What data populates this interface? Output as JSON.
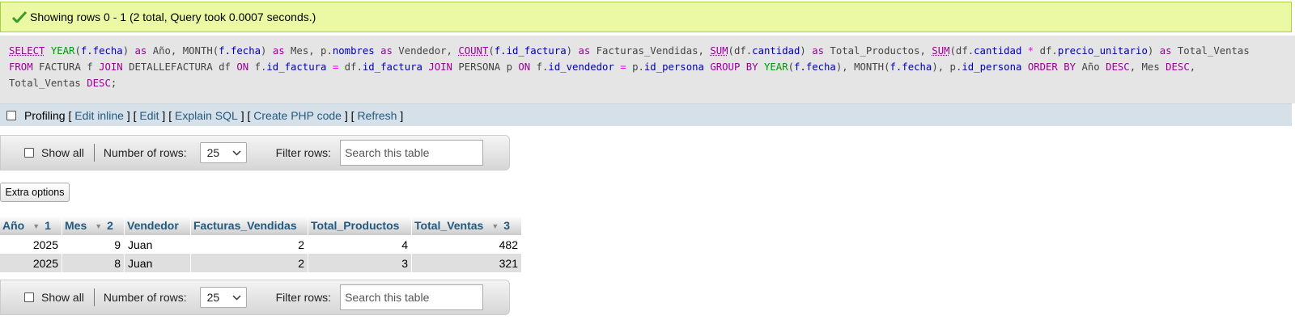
{
  "message": {
    "text": "Showing rows 0 - 1 (2 total, Query took 0.0007 seconds.)",
    "icon": "check-icon",
    "color": "#ebf8a4"
  },
  "sql": {
    "line1": [
      {
        "t": "SELECT",
        "c": "kwu"
      },
      {
        "t": " ",
        "c": "pl"
      },
      {
        "t": "YEAR",
        "c": "fn"
      },
      {
        "t": "(",
        "c": "pl"
      },
      {
        "t": "f.fecha",
        "c": "col"
      },
      {
        "t": ") ",
        "c": "pl"
      },
      {
        "t": "as",
        "c": "kw"
      },
      {
        "t": " Año, ",
        "c": "pl"
      },
      {
        "t": "MONTH",
        "c": "pl"
      },
      {
        "t": "(",
        "c": "pl"
      },
      {
        "t": "f.fecha",
        "c": "col"
      },
      {
        "t": ") ",
        "c": "pl"
      },
      {
        "t": "as",
        "c": "kw"
      },
      {
        "t": " Mes, p.",
        "c": "pl"
      },
      {
        "t": "nombres",
        "c": "col"
      },
      {
        "t": " ",
        "c": "pl"
      },
      {
        "t": "as",
        "c": "kw"
      },
      {
        "t": " Vendedor, ",
        "c": "pl"
      },
      {
        "t": "COUNT",
        "c": "fnu"
      },
      {
        "t": "(",
        "c": "pl"
      },
      {
        "t": "f.id_factura",
        "c": "col"
      },
      {
        "t": ") ",
        "c": "pl"
      },
      {
        "t": "as",
        "c": "kw"
      },
      {
        "t": " Facturas_Vendidas, ",
        "c": "pl"
      },
      {
        "t": "SUM",
        "c": "fnu"
      },
      {
        "t": "(df.",
        "c": "pl"
      },
      {
        "t": "cantidad",
        "c": "col"
      },
      {
        "t": ") ",
        "c": "pl"
      },
      {
        "t": "as",
        "c": "kw"
      },
      {
        "t": " Total_Productos, ",
        "c": "pl"
      },
      {
        "t": "SUM",
        "c": "fnu"
      },
      {
        "t": "(df.",
        "c": "pl"
      },
      {
        "t": "cantidad",
        "c": "col"
      },
      {
        "t": " ",
        "c": "pl"
      },
      {
        "t": "*",
        "c": "op"
      },
      {
        "t": " df.",
        "c": "pl"
      },
      {
        "t": "precio_unitario",
        "c": "col"
      },
      {
        "t": ") ",
        "c": "pl"
      },
      {
        "t": "as",
        "c": "kw"
      },
      {
        "t": " Total_Ventas",
        "c": "pl"
      }
    ],
    "line2": [
      {
        "t": "FROM",
        "c": "kw"
      },
      {
        "t": " FACTURA f ",
        "c": "pl"
      },
      {
        "t": "JOIN",
        "c": "kw"
      },
      {
        "t": " DETALLEFACTURA df ",
        "c": "pl"
      },
      {
        "t": "ON",
        "c": "kw"
      },
      {
        "t": " f.",
        "c": "pl"
      },
      {
        "t": "id_factura",
        "c": "col"
      },
      {
        "t": " ",
        "c": "pl"
      },
      {
        "t": "=",
        "c": "op"
      },
      {
        "t": " df.",
        "c": "pl"
      },
      {
        "t": "id_factura",
        "c": "col"
      },
      {
        "t": " ",
        "c": "pl"
      },
      {
        "t": "JOIN",
        "c": "kw"
      },
      {
        "t": " PERSONA p ",
        "c": "pl"
      },
      {
        "t": "ON",
        "c": "kw"
      },
      {
        "t": " f.",
        "c": "pl"
      },
      {
        "t": "id_vendedor",
        "c": "col"
      },
      {
        "t": " ",
        "c": "pl"
      },
      {
        "t": "=",
        "c": "op"
      },
      {
        "t": " p.",
        "c": "pl"
      },
      {
        "t": "id_persona",
        "c": "col"
      },
      {
        "t": " ",
        "c": "pl"
      },
      {
        "t": "GROUP BY",
        "c": "kw"
      },
      {
        "t": " ",
        "c": "pl"
      },
      {
        "t": "YEAR",
        "c": "fn"
      },
      {
        "t": "(",
        "c": "pl"
      },
      {
        "t": "f.fecha",
        "c": "col"
      },
      {
        "t": "), ",
        "c": "pl"
      },
      {
        "t": "MONTH",
        "c": "pl"
      },
      {
        "t": "(",
        "c": "pl"
      },
      {
        "t": "f.fecha",
        "c": "col"
      },
      {
        "t": "), p.",
        "c": "pl"
      },
      {
        "t": "id_persona",
        "c": "col"
      },
      {
        "t": " ",
        "c": "pl"
      },
      {
        "t": "ORDER BY",
        "c": "kw"
      },
      {
        "t": " Año ",
        "c": "pl"
      },
      {
        "t": "DESC",
        "c": "kw"
      },
      {
        "t": ", Mes ",
        "c": "pl"
      },
      {
        "t": "DESC",
        "c": "kw"
      },
      {
        "t": ",",
        "c": "pl"
      }
    ],
    "line3": [
      {
        "t": "Total_Ventas ",
        "c": "pl"
      },
      {
        "t": "DESC",
        "c": "kw"
      },
      {
        "t": ";",
        "c": "pl"
      }
    ]
  },
  "profiling": {
    "label": "Profiling",
    "open": " [ ",
    "sep": " ] [ ",
    "close": " ]",
    "links": [
      "Edit inline",
      "Edit",
      "Explain SQL",
      "Create PHP code",
      "Refresh"
    ]
  },
  "nav": {
    "show_all": "Show all",
    "rows_label": "Number of rows:",
    "rows_value": "25",
    "filter_label": "Filter rows:",
    "filter_placeholder": "Search this table"
  },
  "extra_options": "Extra options",
  "table": {
    "columns": [
      {
        "name": "Año",
        "sort": "1"
      },
      {
        "name": "Mes",
        "sort": "2"
      },
      {
        "name": "Vendedor"
      },
      {
        "name": "Facturas_Vendidas"
      },
      {
        "name": "Total_Productos"
      },
      {
        "name": "Total_Ventas",
        "sort": "3"
      }
    ],
    "rows": [
      [
        "2025",
        "9",
        "Juan",
        "2",
        "4",
        "482"
      ],
      [
        "2025",
        "8",
        "Juan",
        "2",
        "3",
        "321"
      ]
    ]
  }
}
